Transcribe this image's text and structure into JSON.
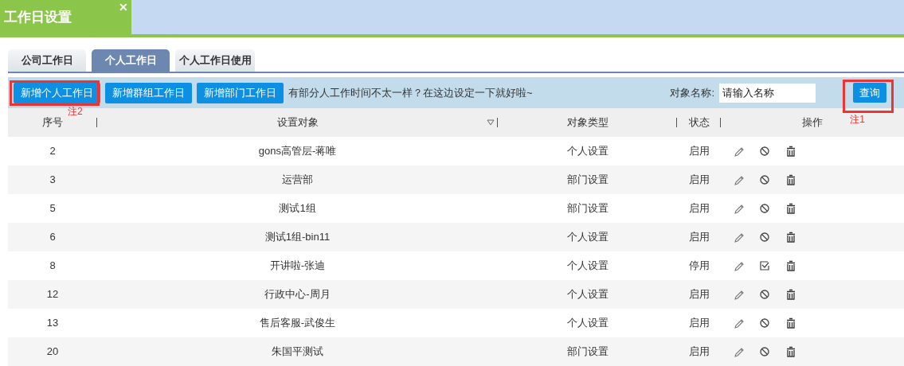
{
  "window": {
    "title": "工作日设置",
    "close": "✕"
  },
  "tabs": [
    {
      "label": "公司工作日",
      "selected": false
    },
    {
      "label": "个人工作日",
      "selected": true
    },
    {
      "label": "个人工作日使用",
      "selected": false
    }
  ],
  "toolbar": {
    "buttons": [
      "新增个人工作日",
      "新增群组工作日",
      "新增部门工作日"
    ],
    "hint": "有部分人工作时间不太一样？在这边设定一下就好啦~",
    "search_label": "对象名称:",
    "search": {
      "placeholder": "请输入名称"
    },
    "query_button": "查询"
  },
  "annotations": [
    {
      "kind": "add",
      "label": "注2"
    },
    {
      "kind": "query",
      "label": "注1"
    }
  ],
  "table": {
    "columns": [
      "序号",
      "设置对象",
      "对象类型",
      "状态",
      "操作"
    ],
    "rows": [
      {
        "id": "2",
        "object": "gons高管层-蒋唯",
        "type": "个人设置",
        "status": "启用",
        "enabled": true
      },
      {
        "id": "3",
        "object": "运营部",
        "type": "部门设置",
        "status": "启用",
        "enabled": true
      },
      {
        "id": "5",
        "object": "测试1组",
        "type": "部门设置",
        "status": "启用",
        "enabled": true
      },
      {
        "id": "6",
        "object": "测试1组-bin11",
        "type": "个人设置",
        "status": "启用",
        "enabled": true
      },
      {
        "id": "8",
        "object": "开讲啦-张迪",
        "type": "个人设置",
        "status": "停用",
        "enabled": false
      },
      {
        "id": "12",
        "object": "行政中心-周月",
        "type": "个人设置",
        "status": "启用",
        "enabled": true
      },
      {
        "id": "13",
        "object": "售后客服-武俊生",
        "type": "个人设置",
        "status": "启用",
        "enabled": true
      },
      {
        "id": "20",
        "object": "朱国平测试",
        "type": "部门设置",
        "status": "启用",
        "enabled": true
      }
    ]
  }
}
